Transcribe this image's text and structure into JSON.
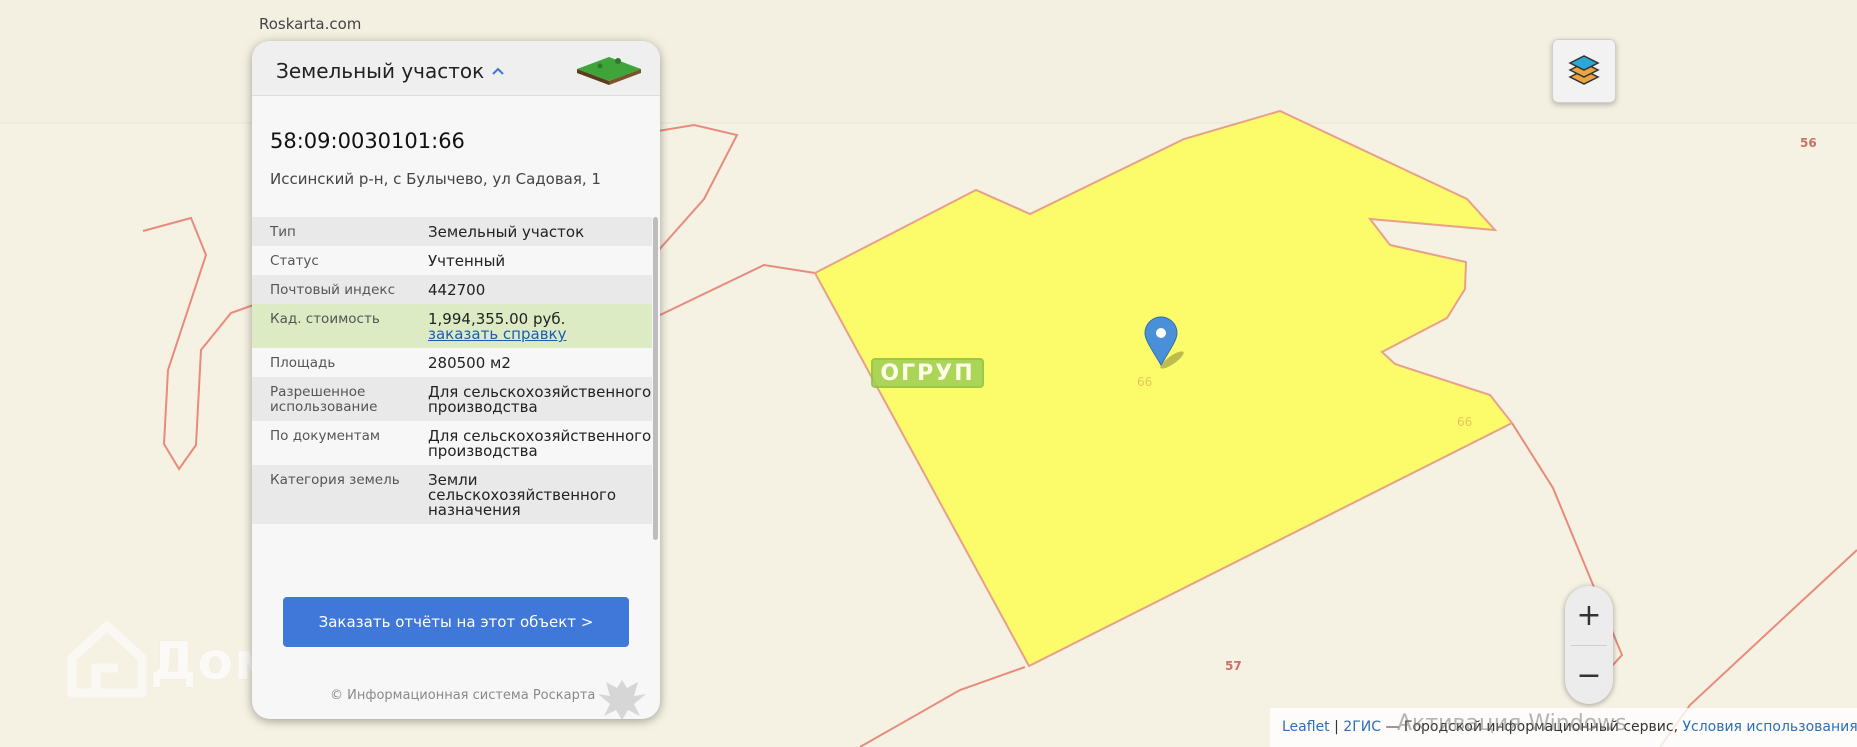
{
  "site": {
    "name": "Roskarta.com"
  },
  "panel": {
    "title": "Земельный участок",
    "cad_number": "58:09:0030101:66",
    "address": "Иссинский р-н, с Булычево, ул Садовая, 1",
    "properties": [
      {
        "key": "Тип",
        "value": "Земельный участок"
      },
      {
        "key": "Статус",
        "value": "Учтенный"
      },
      {
        "key": "Почтовый индекс",
        "value": "442700"
      },
      {
        "key": "Кад. стоимость",
        "value": "1,994,355.00 руб.",
        "link": "заказать справку"
      },
      {
        "key": "Площадь",
        "value": "280500 м2"
      },
      {
        "key": "Разрешенное использование",
        "value": "Для сельскохозяйственного производства"
      },
      {
        "key": "По документам",
        "value": "Для сельскохозяйственного производства"
      },
      {
        "key": "Категория земель",
        "value": "Земли сельскохозяйственного назначения"
      }
    ],
    "order_button": "Заказать отчёты на этот объект >",
    "copyright": "© Информационная система Роскарта"
  },
  "map": {
    "parcel_labels": [
      "66",
      "66",
      "56",
      "57"
    ],
    "ogrup_badge": "ОГРУП",
    "watermark": "Домклик",
    "zoom_in": "+",
    "zoom_out": "−",
    "colors": {
      "parcel_fill": "#fcfc6a",
      "parcel_stroke": "#e88a7a",
      "boundary": "#e78c7d",
      "marker": "#4a90d9"
    }
  },
  "attribution": {
    "leaflet": "Leaflet",
    "sep1": " | ",
    "twogis": "2ГИС",
    "twogis_desc": " — Городской информационный сервис, ",
    "terms": "Условия использования",
    "tail": ", ©"
  },
  "os_overlay": {
    "activation": "Активация Windows"
  }
}
